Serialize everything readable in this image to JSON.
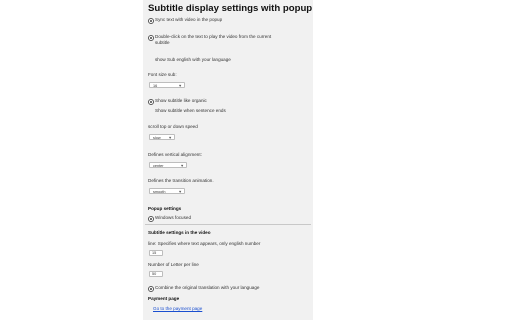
{
  "header": {
    "title": "Subtitle display settings with popup"
  },
  "options": {
    "sync_text": "Sync text with video in the popup",
    "double_click_line1": "Double-click on the text to play the video from the current",
    "double_click_line2": "subtitle",
    "show_sub_english": "show Sub english with your language"
  },
  "font_size": {
    "label": "Font size sub:",
    "value": "16"
  },
  "subtitle_mode": {
    "organic": "Show subtitle like organic",
    "sentence_end": "Show subtitle when sentence ends"
  },
  "scroll_speed": {
    "label": "scroll top or down speed",
    "value": "slow"
  },
  "vertical_alignment": {
    "label": "Defines vertical alignment:",
    "value": "center"
  },
  "transition": {
    "label": "Defines the transition animation.",
    "value": "smooth"
  },
  "popup_settings": {
    "heading": "Popup settings",
    "windows_focused": "Windows focused"
  },
  "video_subtitle": {
    "heading": "Subtitle settings in the video",
    "line_label": "line: Specifies where text appears, only english number",
    "line_value": "15",
    "letters_label": "Number of Letter per line",
    "letters_value": "50",
    "combine": "Combine the original translation with your language"
  },
  "payment": {
    "heading": "Payment page",
    "link": "Go to the payment page"
  }
}
